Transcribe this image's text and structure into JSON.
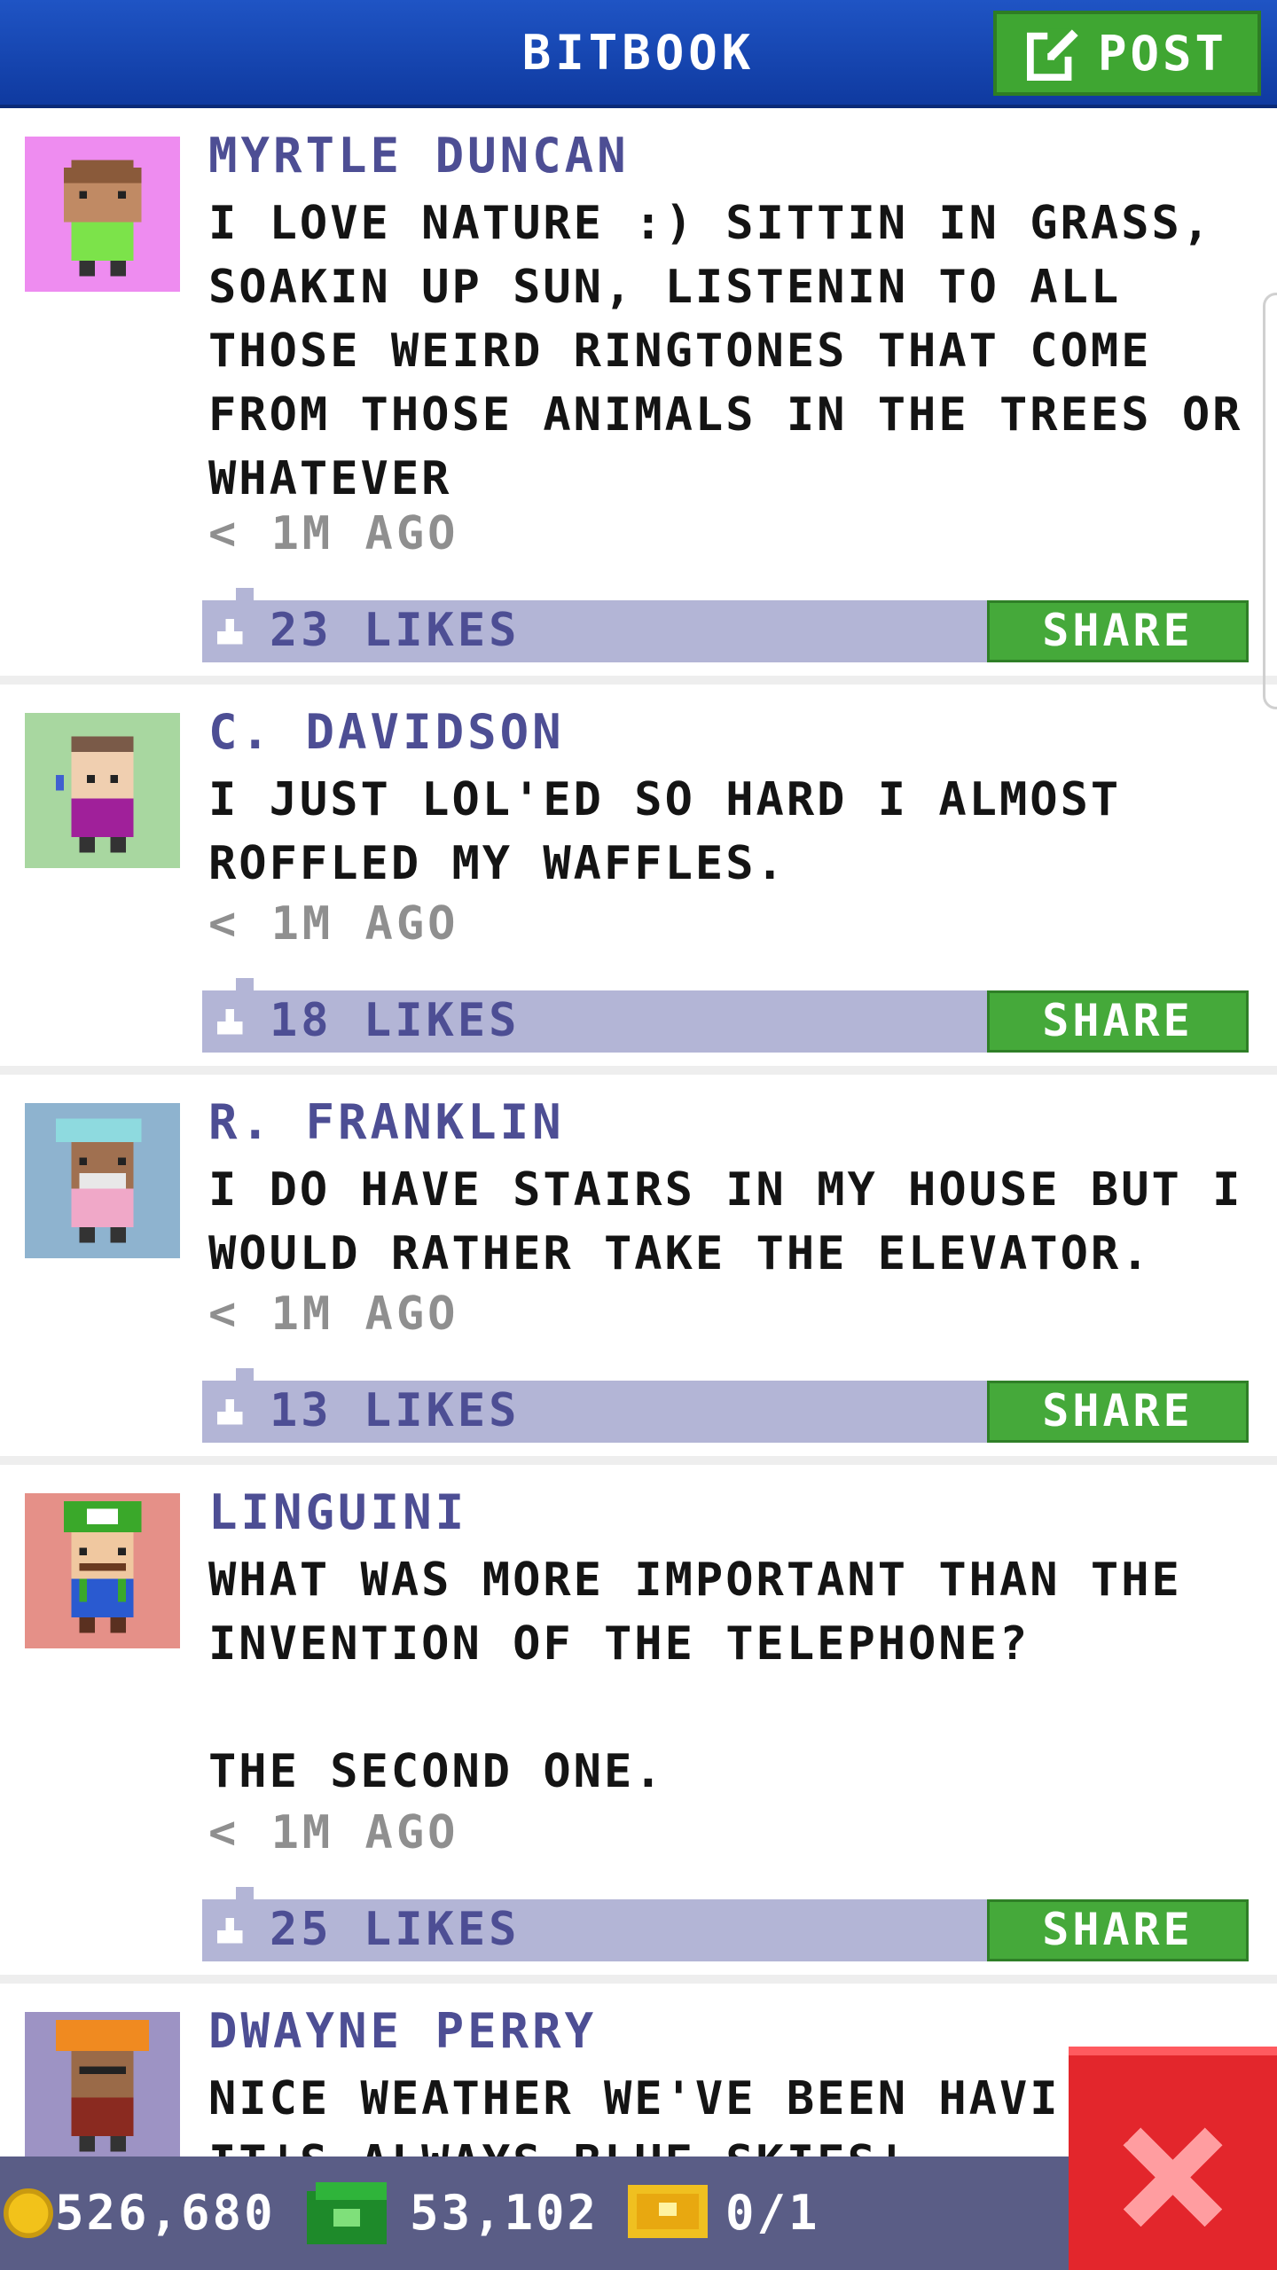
{
  "header": {
    "title": "BITBOOK",
    "post_label": "POST"
  },
  "posts": [
    {
      "author": "MYRTLE DUNCAN",
      "text": "I LOVE NATURE :) SITTIN IN GRASS,\nSOAKIN UP SUN, LISTENIN TO ALL\nTHOSE WEIRD RINGTONES THAT COME\nFROM THOSE ANIMALS IN THE TREES OR\nWHATEVER",
      "time": "< 1M AGO",
      "likes": "23 LIKES",
      "share_label": "SHARE",
      "avatar_bg": "#ee8cf0"
    },
    {
      "author": "C. DAVIDSON",
      "text": "I JUST LOL'ED SO HARD I ALMOST\nROFFLED MY WAFFLES.",
      "time": "< 1M AGO",
      "likes": "18 LIKES",
      "share_label": "SHARE",
      "avatar_bg": "#a8d7a0"
    },
    {
      "author": "R. FRANKLIN",
      "text": "I DO HAVE STAIRS IN MY HOUSE BUT I\nWOULD RATHER TAKE THE ELEVATOR.",
      "time": "< 1M AGO",
      "likes": "13 LIKES",
      "share_label": "SHARE",
      "avatar_bg": "#8eb3cf"
    },
    {
      "author": "LINGUINI",
      "text": "WHAT WAS MORE IMPORTANT THAN THE\nINVENTION OF THE TELEPHONE?\n\nTHE SECOND ONE.",
      "time": "< 1M AGO",
      "likes": "25 LIKES",
      "share_label": "SHARE",
      "avatar_bg": "#e59088"
    },
    {
      "author": "DWAYNE PERRY",
      "text": "NICE WEATHER WE'VE BEEN HAVI\nIT'S ALWAYS BLUE SKIES!",
      "avatar_bg": "#9d93c4"
    }
  ],
  "bottom_bar": {
    "coins": "526,680",
    "bux": "53,102",
    "tickets": "0/1"
  },
  "colors": {
    "header": "#1546b0",
    "accent_green": "#45a93a",
    "like_bar": "#b3b5d6",
    "author": "#4d4e94",
    "close_red": "#e3262c"
  }
}
